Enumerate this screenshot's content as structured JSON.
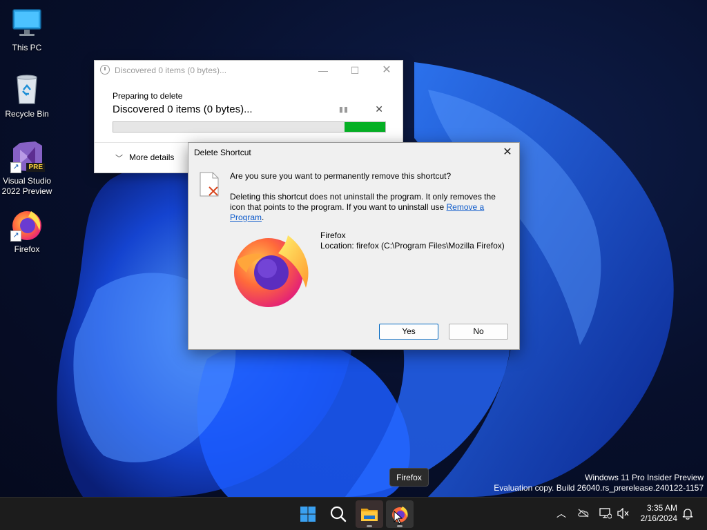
{
  "desktop": {
    "icons": [
      {
        "label": "This PC",
        "icon": "monitor-icon"
      },
      {
        "label": "Recycle Bin",
        "icon": "recycle-bin-icon"
      },
      {
        "label": "Visual Studio 2022 Preview",
        "icon": "visual-studio-icon",
        "badge": "PRE"
      },
      {
        "label": "Firefox",
        "icon": "firefox-icon"
      }
    ]
  },
  "progress_window": {
    "title": "Discovered 0 items (0 bytes)...",
    "subtitle": "Preparing to delete",
    "main_text": "Discovered 0 items (0 bytes)...",
    "progress_fraction": 0.15,
    "more_details_label": "More details",
    "accent": "#06b025"
  },
  "delete_dialog": {
    "title": "Delete Shortcut",
    "question": "Are you sure you want to permanently remove this shortcut?",
    "description_prefix": "Deleting this shortcut does not uninstall the program. It only removes the icon that points to the program. If you want to uninstall use ",
    "link_text": "Remove a Program",
    "description_suffix": ".",
    "item_name": "Firefox",
    "item_location": "Location: firefox (C:\\Program Files\\Mozilla Firefox)",
    "yes_label": "Yes",
    "no_label": "No"
  },
  "tooltip": {
    "text": "Firefox"
  },
  "watermark": {
    "line1": "Windows 11 Pro Insider Preview",
    "line2": "Evaluation copy. Build 26040.rs_prerelease.240122-1157"
  },
  "taskbar": {
    "items": [
      {
        "icon": "windows-start-icon"
      },
      {
        "icon": "search-icon"
      },
      {
        "icon": "file-explorer-icon"
      },
      {
        "icon": "firefox-icon"
      }
    ],
    "tray": [
      "chevron-up-icon",
      "onedrive-icon",
      "network-icon",
      "speaker-muted-icon"
    ],
    "time": "3:35 AM",
    "date": "2/16/2024"
  }
}
